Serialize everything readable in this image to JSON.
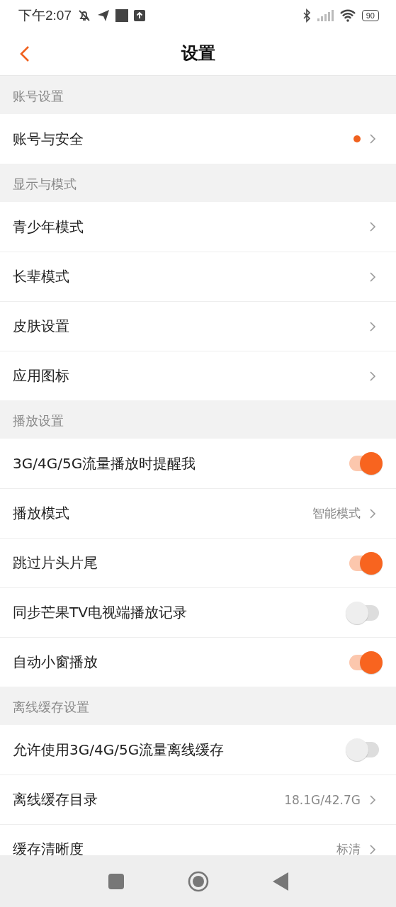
{
  "status_bar": {
    "time": "下午2:07",
    "battery": "90"
  },
  "header": {
    "title": "设置"
  },
  "sections": [
    {
      "title": "账号设置",
      "rows": [
        {
          "kind": "link",
          "label": "账号与安全",
          "dot": true
        }
      ]
    },
    {
      "title": "显示与模式",
      "rows": [
        {
          "kind": "link",
          "label": "青少年模式"
        },
        {
          "kind": "link",
          "label": "长辈模式"
        },
        {
          "kind": "link",
          "label": "皮肤设置"
        },
        {
          "kind": "link",
          "label": "应用图标"
        }
      ]
    },
    {
      "title": "播放设置",
      "rows": [
        {
          "kind": "toggle",
          "label": "3G/4G/5G流量播放时提醒我",
          "on": true
        },
        {
          "kind": "link",
          "label": "播放模式",
          "value": "智能模式"
        },
        {
          "kind": "toggle",
          "label": "跳过片头片尾",
          "on": true
        },
        {
          "kind": "toggle",
          "label": "同步芒果TV电视端播放记录",
          "on": false
        },
        {
          "kind": "toggle",
          "label": "自动小窗播放",
          "on": true
        }
      ]
    },
    {
      "title": "离线缓存设置",
      "rows": [
        {
          "kind": "toggle",
          "label": "允许使用3G/4G/5G流量离线缓存",
          "on": false
        },
        {
          "kind": "link",
          "label": "离线缓存目录",
          "value": "18.1G/42.7G"
        },
        {
          "kind": "link",
          "label": "缓存清晰度",
          "value": "标清"
        }
      ]
    }
  ]
}
